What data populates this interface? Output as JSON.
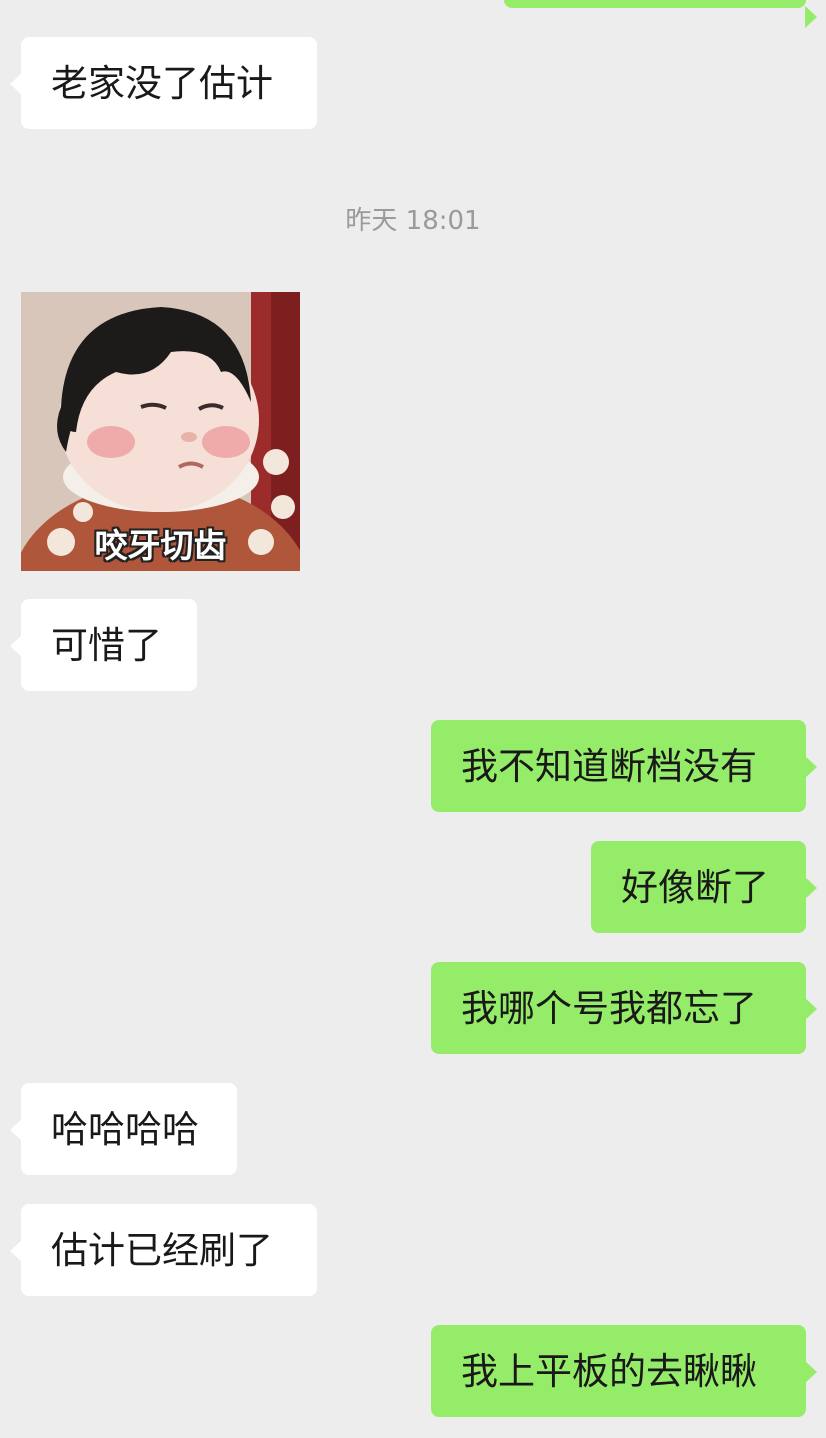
{
  "chat": {
    "messages": [
      {
        "side": "right",
        "text": ""
      },
      {
        "side": "left",
        "text": "老家没了估计"
      },
      {
        "side": "left",
        "sticker_caption": "咬牙切齿"
      },
      {
        "side": "left",
        "text": "可惜了"
      },
      {
        "side": "right",
        "text": "我不知道断档没有"
      },
      {
        "side": "right",
        "text": "好像断了"
      },
      {
        "side": "right",
        "text": "我哪个号我都忘了"
      },
      {
        "side": "left",
        "text": "哈哈哈哈"
      },
      {
        "side": "left",
        "text": "估计已经刷了"
      },
      {
        "side": "right",
        "text": "我上平板的去瞅瞅"
      }
    ],
    "timestamp": "昨天 18:01"
  },
  "colors": {
    "background": "#ededed",
    "bubble_left": "#ffffff",
    "bubble_right": "#95ec69",
    "timestamp_text": "#9a9a9a"
  }
}
